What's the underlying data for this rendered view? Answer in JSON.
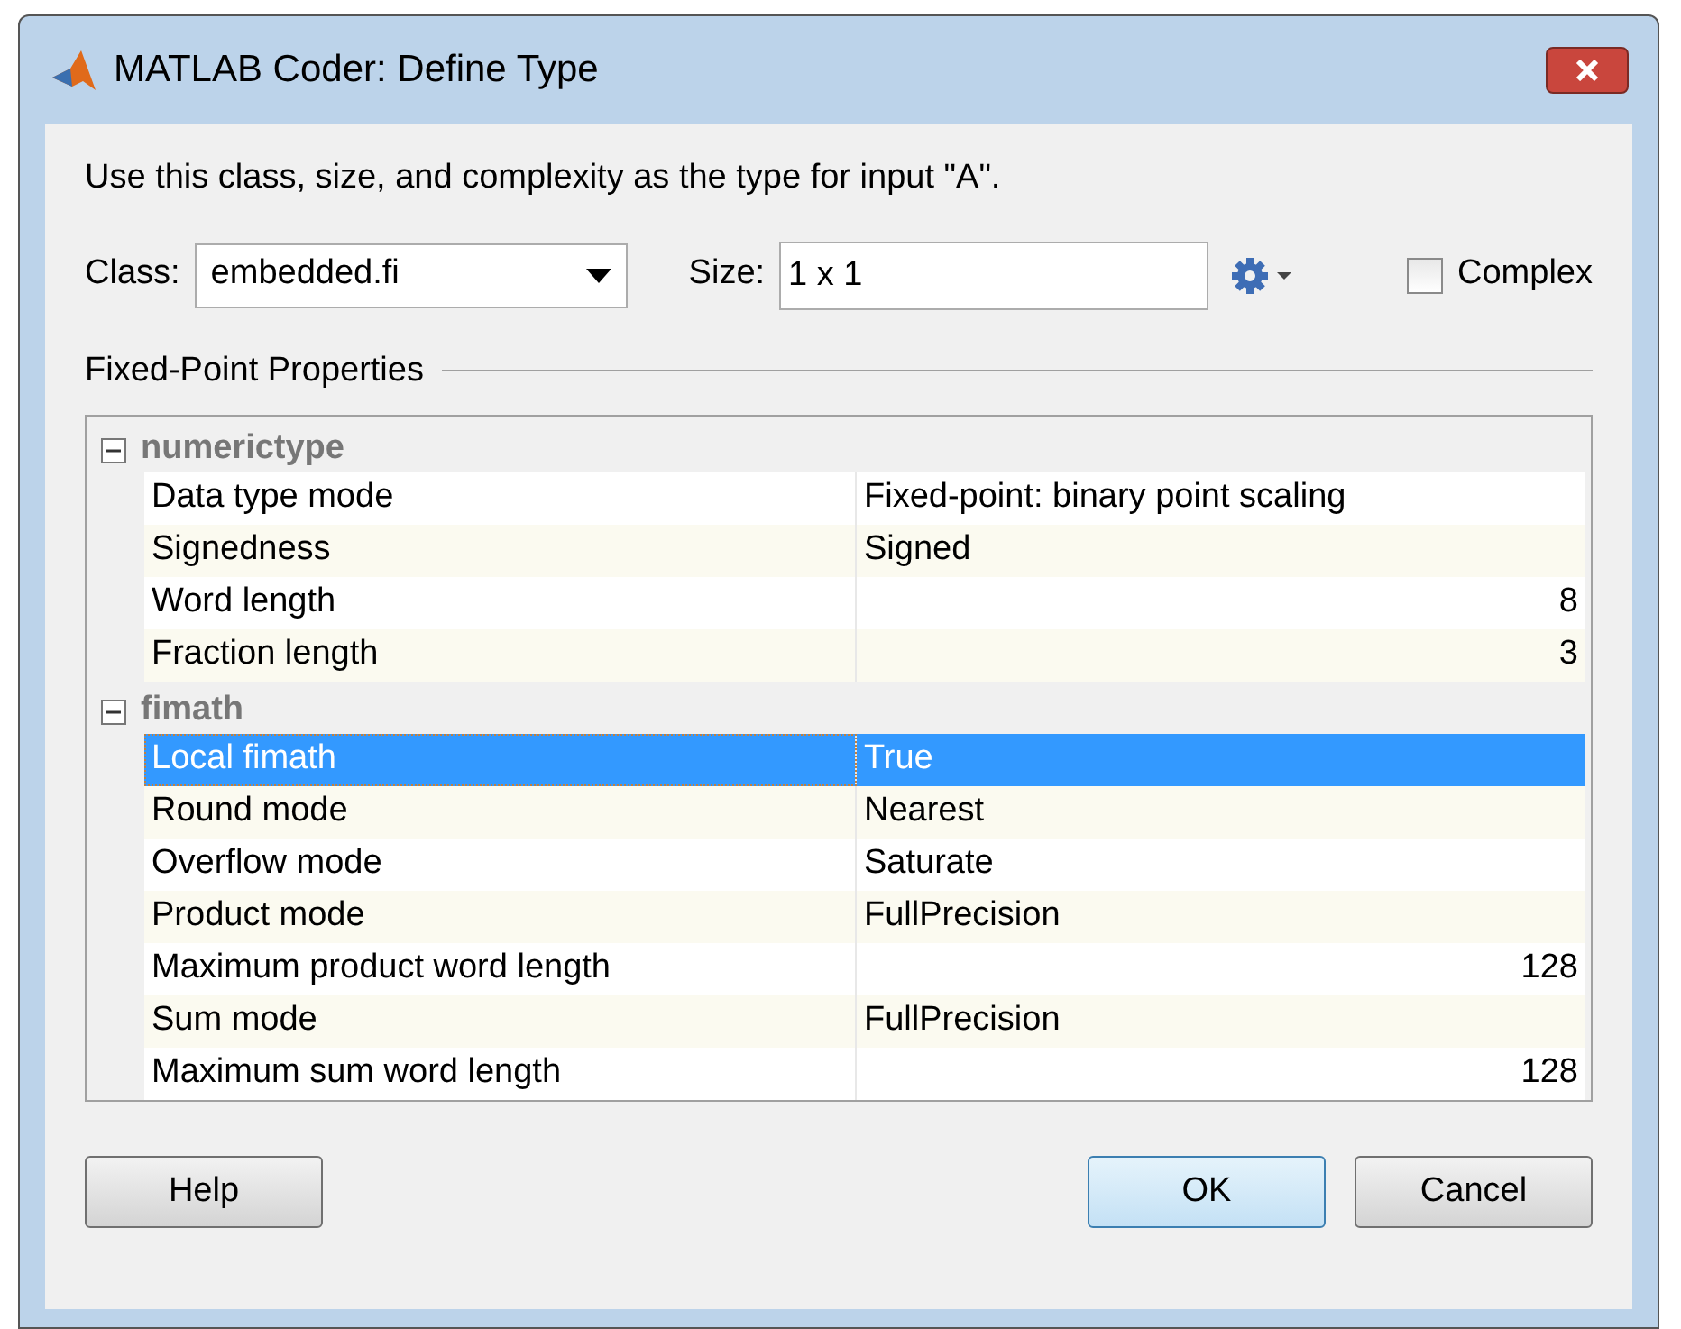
{
  "window": {
    "title": "MATLAB Coder: Define Type"
  },
  "instruction": "Use this class, size, and complexity as the type for input \"A\".",
  "class_field": {
    "label": "Class:",
    "value": "embedded.fi"
  },
  "size_field": {
    "label": "Size:",
    "value": "1 x 1"
  },
  "complex": {
    "label": "Complex",
    "checked": false
  },
  "section_title": "Fixed-Point Properties",
  "groups": [
    {
      "name": "numerictype",
      "expanded": true,
      "rows": [
        {
          "label": "Data type mode",
          "value": "Fixed-point: binary point scaling",
          "kind": "text",
          "selected": false
        },
        {
          "label": "Signedness",
          "value": "Signed",
          "kind": "text",
          "selected": false
        },
        {
          "label": "Word length",
          "value": "8",
          "kind": "number",
          "selected": false
        },
        {
          "label": "Fraction length",
          "value": "3",
          "kind": "number",
          "selected": false
        }
      ]
    },
    {
      "name": "fimath",
      "expanded": true,
      "rows": [
        {
          "label": "Local fimath",
          "value": "True",
          "kind": "text",
          "selected": true
        },
        {
          "label": "Round mode",
          "value": "Nearest",
          "kind": "text",
          "selected": false
        },
        {
          "label": "Overflow mode",
          "value": "Saturate",
          "kind": "text",
          "selected": false
        },
        {
          "label": "Product mode",
          "value": "FullPrecision",
          "kind": "text",
          "selected": false
        },
        {
          "label": "Maximum product word length",
          "value": "128",
          "kind": "number",
          "selected": false
        },
        {
          "label": "Sum mode",
          "value": "FullPrecision",
          "kind": "text",
          "selected": false
        },
        {
          "label": "Maximum sum word length",
          "value": "128",
          "kind": "number",
          "selected": false
        }
      ]
    }
  ],
  "buttons": [
    {
      "label": "Help",
      "kind": "help"
    },
    {
      "label": "OK",
      "kind": "default"
    },
    {
      "label": "Cancel",
      "kind": "normal"
    }
  ]
}
